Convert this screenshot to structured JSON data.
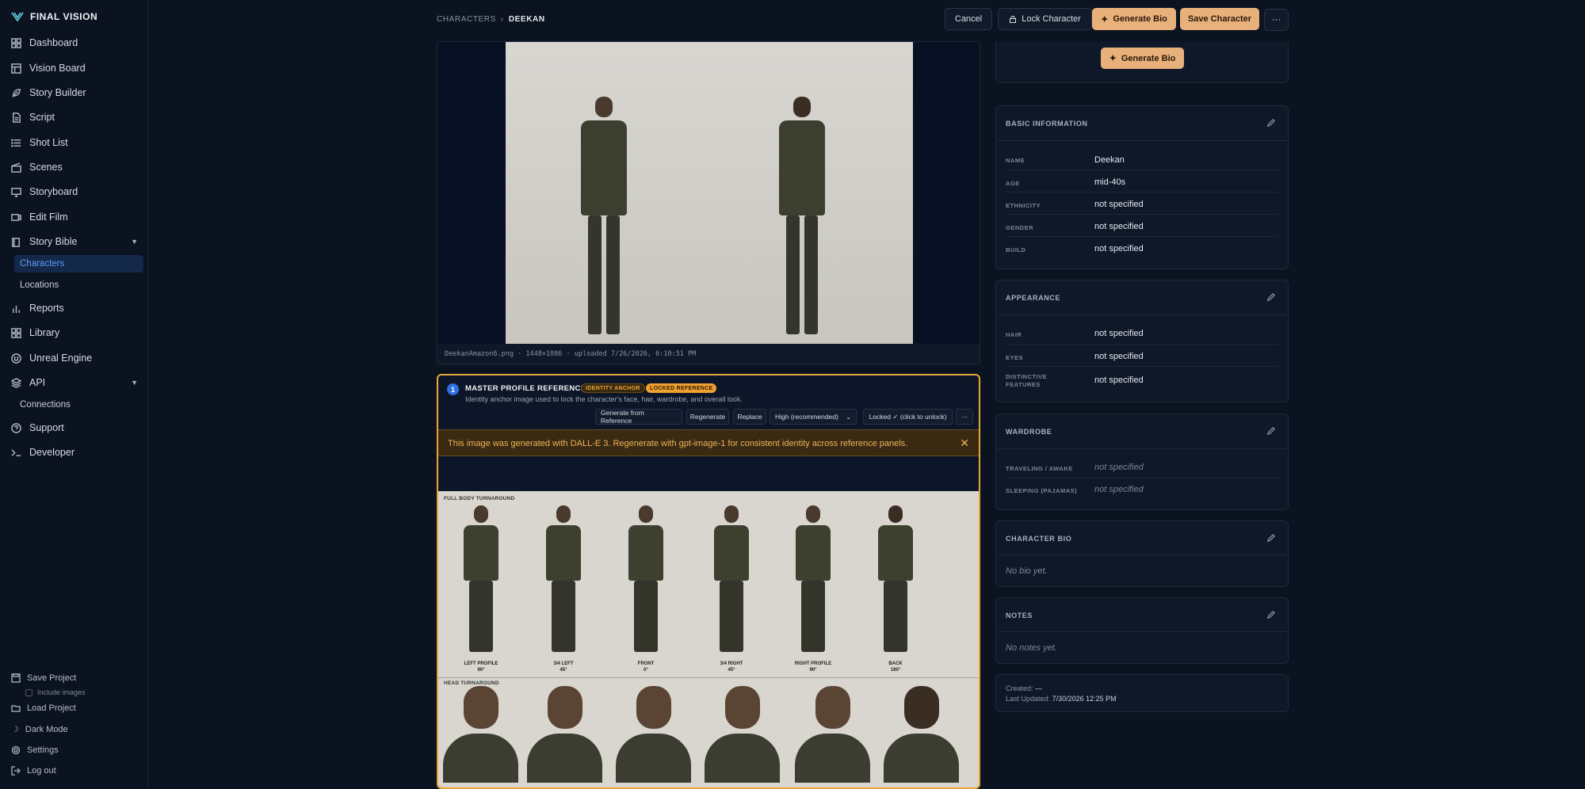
{
  "app": {
    "name": "FINAL VISION"
  },
  "sidebar": {
    "items": [
      {
        "label": "Dashboard",
        "icon": "grid-icon"
      },
      {
        "label": "Vision Board",
        "icon": "board-icon"
      },
      {
        "label": "Story Builder",
        "icon": "feather-icon"
      },
      {
        "label": "Script",
        "icon": "file-icon"
      },
      {
        "label": "Shot List",
        "icon": "list-icon"
      },
      {
        "label": "Scenes",
        "icon": "clapper-icon"
      },
      {
        "label": "Storyboard",
        "icon": "monitor-icon"
      },
      {
        "label": "Edit Film",
        "icon": "video-icon"
      },
      {
        "label": "Story Bible",
        "icon": "book-icon"
      },
      {
        "label": "Reports",
        "icon": "bar-chart-icon"
      },
      {
        "label": "Library",
        "icon": "library-icon"
      },
      {
        "label": "Unreal Engine",
        "icon": "unreal-icon"
      },
      {
        "label": "API",
        "icon": "layers-icon"
      },
      {
        "label": "Support",
        "icon": "help-icon"
      },
      {
        "label": "Developer",
        "icon": "terminal-icon"
      }
    ],
    "story_bible_sub": [
      "Characters",
      "Locations"
    ],
    "api_sub": [
      "Connections"
    ],
    "bottom": {
      "save_project": "Save Project",
      "include_images": "Include images",
      "load_project": "Load Project",
      "dark_mode": "Dark Mode",
      "settings": "Settings",
      "log_out": "Log out"
    }
  },
  "header": {
    "breadcrumb_root": "CHARACTERS",
    "breadcrumb_sep": "›",
    "breadcrumb_current": "DEEKAN",
    "cancel": "Cancel",
    "lock_character": "Lock Character",
    "generate_bio": "Generate Bio",
    "save_character": "Save Character",
    "more": "···"
  },
  "main_image": {
    "caption": "DeekanAmazon6.png · 1448×1086 · uploaded 7/26/2026, 6:10:51 PM"
  },
  "master_profile": {
    "number": "1",
    "title": "MASTER PROFILE REFERENCE",
    "badge_identity": "IDENTITY ANCHOR",
    "badge_locked": "LOCKED REFERENCE",
    "description": "Identity anchor image used to lock the character's face, hair, wardrobe, and overall look.",
    "buttons": {
      "generate_from_reference": "Generate from Reference",
      "regenerate": "Regenerate",
      "replace": "Replace",
      "quality": "High (recommended)",
      "locked": "Locked ✓ (click to unlock)",
      "more": "···"
    },
    "warning": "This image was generated with DALL-E 3. Regenerate with gpt-image-1 for consistent identity across reference panels.",
    "sheet": {
      "full_body_label": "FULL BODY TURNAROUND",
      "head_label": "HEAD TURNAROUND",
      "views": [
        {
          "name": "LEFT PROFILE",
          "angle": "90°"
        },
        {
          "name": "3/4 LEFT",
          "angle": "45°"
        },
        {
          "name": "FRONT",
          "angle": "0°"
        },
        {
          "name": "3/4 RIGHT",
          "angle": "45°"
        },
        {
          "name": "RIGHT PROFILE",
          "angle": "90°"
        },
        {
          "name": "BACK",
          "angle": "180°"
        }
      ]
    }
  },
  "right": {
    "generate_bio": "Generate Bio",
    "basic": {
      "title": "BASIC INFORMATION",
      "fields": [
        {
          "label": "NAME",
          "value": "Deekan"
        },
        {
          "label": "AGE",
          "value": "mid-40s"
        },
        {
          "label": "ETHNICITY",
          "value": "not specified"
        },
        {
          "label": "GENDER",
          "value": "not specified"
        },
        {
          "label": "BUILD",
          "value": "not specified"
        }
      ]
    },
    "appearance": {
      "title": "APPEARANCE",
      "fields": [
        {
          "label": "HAIR",
          "value": "not specified"
        },
        {
          "label": "EYES",
          "value": "not specified"
        },
        {
          "label": "DISTINCTIVE FEATURES",
          "value": "not specified"
        }
      ]
    },
    "wardrobe": {
      "title": "WARDROBE",
      "fields": [
        {
          "label": "TRAVELING / AWAKE",
          "value": "not specified"
        },
        {
          "label": "SLEEPING (PAJAMAS)",
          "value": "not specified"
        }
      ]
    },
    "bio": {
      "title": "CHARACTER BIO",
      "empty": "No bio yet."
    },
    "notes": {
      "title": "NOTES",
      "empty": "No notes yet."
    },
    "meta": {
      "created_label": "Created:",
      "created_value": "—",
      "updated_label": "Last Updated:",
      "updated_value": "7/30/2026 12:25 PM"
    }
  },
  "colors": {
    "accent_amber": "#e8b07a",
    "active_blue": "#5b9bf5",
    "warning": "#f0b45a"
  }
}
